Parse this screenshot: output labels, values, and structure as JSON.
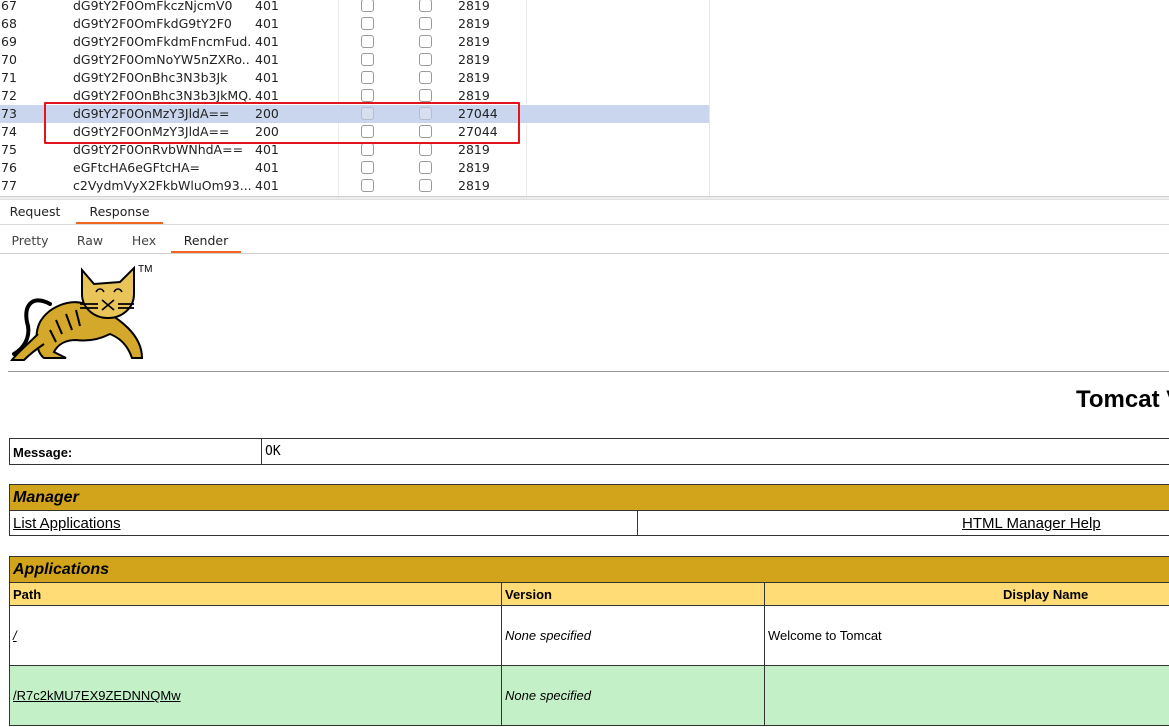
{
  "results": {
    "rows": [
      {
        "num": "67",
        "payload": "dG9tY2F0OmFkczNjcmV0",
        "status": "401",
        "length": "2819",
        "selected": false
      },
      {
        "num": "68",
        "payload": "dG9tY2F0OmFkdG9tY2F0",
        "status": "401",
        "length": "2819",
        "selected": false
      },
      {
        "num": "69",
        "payload": "dG9tY2F0OmFkdmFncmFudGFnZQ==",
        "display_payload": "dG9tY2F0OmFkdmFncmFud...",
        "status": "401",
        "length": "2819",
        "selected": false
      },
      {
        "num": "70",
        "payload": "dG9tY2F0OmNoYW5nZXRoaXM=",
        "display_payload": "dG9tY2F0OmNoYW5nZXRo...",
        "status": "401",
        "length": "2819",
        "selected": false
      },
      {
        "num": "71",
        "payload": "dG9tY2F0OnBhc3N3b3Jk",
        "status": "401",
        "length": "2819",
        "selected": false
      },
      {
        "num": "72",
        "payload": "dG9tY2F0OnBhc3N3b3JkMQ==",
        "display_payload": "dG9tY2F0OnBhc3N3b3JkMQ...",
        "status": "401",
        "length": "2819",
        "selected": false
      },
      {
        "num": "73",
        "payload": "dG9tY2F0OnMzY3JldA==",
        "status": "200",
        "length": "27044",
        "selected": true
      },
      {
        "num": "74",
        "payload": "dG9tY2F0OnMzY3JldA==",
        "status": "200",
        "length": "27044",
        "selected": false
      },
      {
        "num": "75",
        "payload": "dG9tY2F0OnRvbWNhdA==",
        "status": "401",
        "length": "2819",
        "selected": false
      },
      {
        "num": "76",
        "payload": "eGFtcHA6eGFtcHA=",
        "status": "401",
        "length": "2819",
        "selected": false
      },
      {
        "num": "77",
        "payload": "c2VydmVyX2FkbWluOm93...",
        "status": "401",
        "length": "2819",
        "selected": false
      }
    ]
  },
  "main_tabs": {
    "request": "Request",
    "response": "Response",
    "active": "response"
  },
  "sub_tabs": {
    "pretty": "Pretty",
    "raw": "Raw",
    "hex": "Hex",
    "render": "Render",
    "active": "render"
  },
  "render": {
    "logo_tm": "TM",
    "heading": "Tomcat V",
    "message_label": "Message:",
    "message_value": "OK",
    "manager": {
      "header": "Manager",
      "list_apps": "List Applications",
      "help": "HTML Manager Help"
    },
    "applications": {
      "header": "Applications",
      "col_path": "Path",
      "col_version": "Version",
      "col_display_name": "Display Name",
      "rows": [
        {
          "path": "/",
          "version": "None specified",
          "display_name": "Welcome to Tomcat"
        },
        {
          "path": "/R7c2kMU7EX9ZEDNNQMw",
          "version": "None specified",
          "display_name": ""
        }
      ]
    }
  },
  "colors": {
    "accent_tab": "#f26522",
    "highlight_box": "#e3141b",
    "selected_row": "#c9d6ee",
    "tomcat_gold": "#d2a41c",
    "tomcat_light": "#ffdc75",
    "tomcat_green": "#c3f0c6"
  }
}
